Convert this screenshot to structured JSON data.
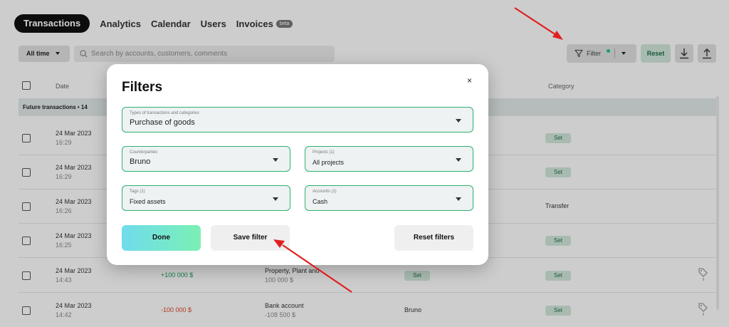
{
  "tabs": {
    "active": "Transactions",
    "items": [
      "Analytics",
      "Calendar",
      "Users",
      "Invoices"
    ],
    "badge": "beta"
  },
  "toolbar": {
    "period": "All time",
    "search_placeholder": "Search by accounts, customers, comments",
    "filter_label": "Filter",
    "reset_label": "Reset"
  },
  "table": {
    "date_header": "Date",
    "category_header": "Category",
    "future_label": "Future transactions • 14",
    "rows": [
      {
        "date": "24 Mar 2023",
        "time": "16:29",
        "amount": "",
        "account": "",
        "account_sub": "",
        "counterparty": "",
        "category": "Set"
      },
      {
        "date": "24 Mar 2023",
        "time": "16:29",
        "amount": "",
        "account": "",
        "account_sub": "",
        "counterparty": "",
        "category": "Set"
      },
      {
        "date": "24 Mar 2023",
        "time": "16:26",
        "amount": "",
        "account": "",
        "account_sub": "",
        "counterparty": "",
        "category": "Transfer"
      },
      {
        "date": "24 Mar 2023",
        "time": "16:25",
        "amount": "",
        "account": "",
        "account_sub": "",
        "counterparty": "",
        "category": "Set"
      },
      {
        "date": "24 Mar 2023",
        "time": "14:43",
        "amount": "+100 000 $",
        "account": "Property, Plant and",
        "account_sub": "100 000 $",
        "counterparty": "Set",
        "category": "Set"
      },
      {
        "date": "24 Mar 2023",
        "time": "14:42",
        "amount": "-100 000 $",
        "account": "Bank account",
        "account_sub": "-108 500 $",
        "counterparty": "Bruno",
        "category": "Set"
      }
    ]
  },
  "modal": {
    "title": "Filters",
    "close": "×",
    "types": {
      "label": "Types of transactions and categories",
      "value": "Purchase of goods"
    },
    "counterparties": {
      "label": "Counterparties",
      "value": "Bruno"
    },
    "projects": {
      "label": "Projects (1)",
      "value": "All projects"
    },
    "tags": {
      "label": "Tags (1)",
      "value": "Fixed assets"
    },
    "accounts": {
      "label": "Accounts (1)",
      "value": "Cash"
    },
    "done": "Done",
    "save": "Save filter",
    "reset": "Reset filters"
  },
  "colors": {
    "accent_green": "#2db36d",
    "annotation_red": "#e02020",
    "done_gradient_start": "#6fdcec",
    "done_gradient_end": "#7af0b4"
  },
  "icons": [
    "search-icon",
    "filter-icon",
    "download-icon",
    "upload-icon",
    "tag-icon",
    "close-icon",
    "chevron-down-icon",
    "arrow-annotation-icon"
  ]
}
